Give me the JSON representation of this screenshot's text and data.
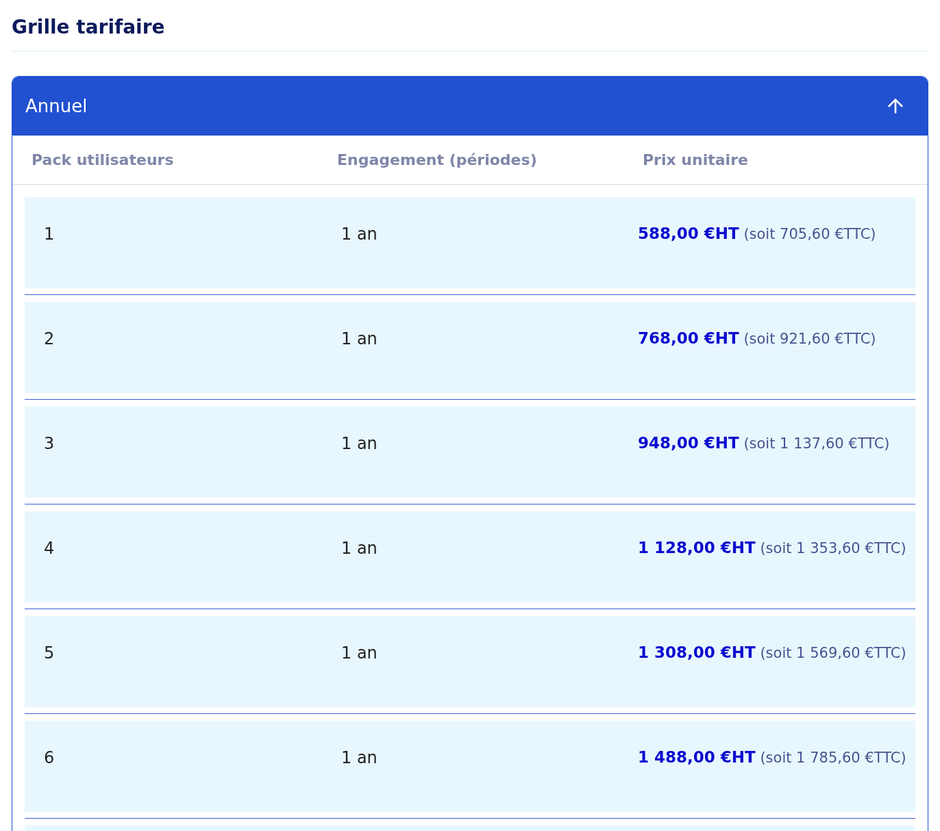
{
  "page_title": "Grille tarifaire",
  "accordion": {
    "title": "Annuel",
    "expanded": true
  },
  "table": {
    "columns": [
      "Pack utilisateurs",
      "Engagement (périodes)",
      "Prix unitaire"
    ],
    "rows": [
      {
        "users": "1",
        "commitment": "1 an",
        "price": "**588,00 €HT** (soit 705,60 €TTC)"
      },
      {
        "users": "2",
        "commitment": "1 an",
        "price": "**768,00 €HT** (soit 921,60 €TTC)"
      },
      {
        "users": "3",
        "commitment": "1 an",
        "price": "**948,00 €HT** (soit 1 137,60 €TTC)"
      },
      {
        "users": "4",
        "commitment": "1 an",
        "price": "**1 128,00 €HT** (soit 1 353,60 €TTC)"
      },
      {
        "users": "5",
        "commitment": "1 an",
        "price": "**1 308,00 €HT** (soit 1 569,60 €TTC)"
      },
      {
        "users": "6",
        "commitment": "1 an",
        "price": "**1 488,00 €HT** (soit 1 785,60 €TTC)"
      }
    ]
  }
}
